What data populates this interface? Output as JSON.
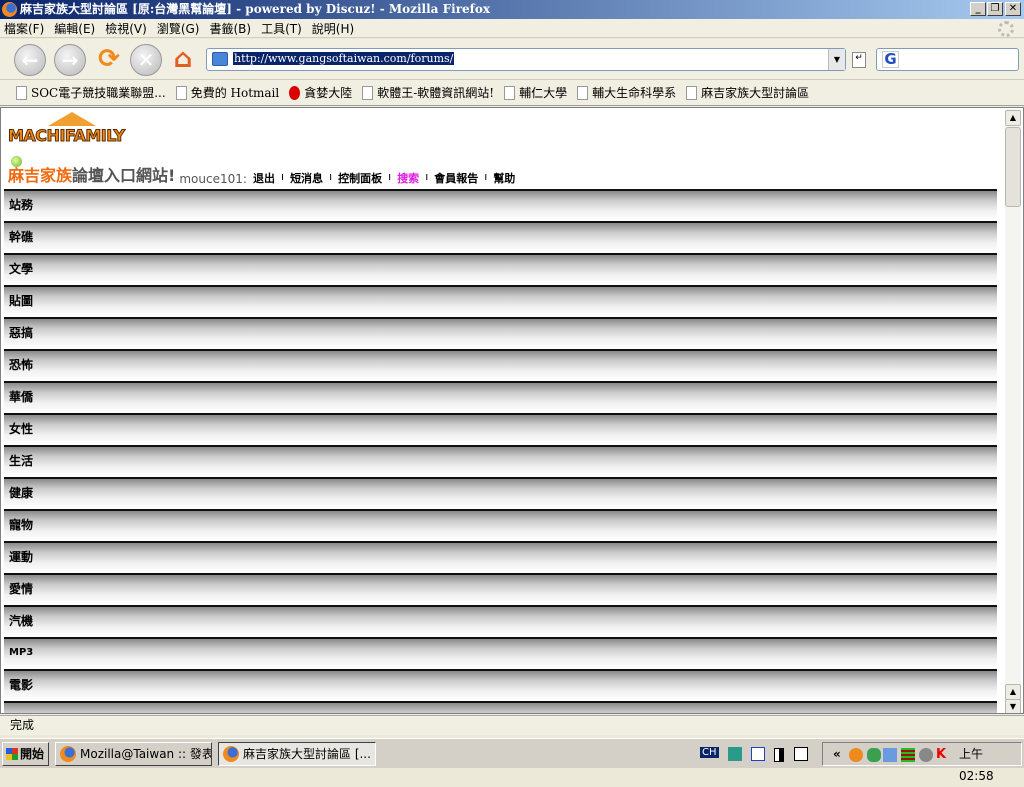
{
  "window": {
    "title": "麻吉家族大型討論區 [原:台灣黑幫論壇] - powered by Discuz! - Mozilla Firefox"
  },
  "menu": [
    "檔案(F)",
    "編輯(E)",
    "檢視(V)",
    "瀏覽(G)",
    "書籤(B)",
    "工具(T)",
    "說明(H)"
  ],
  "url": "http://www.gangsoftaiwan.com/forums/",
  "search": {
    "engine_label": "G"
  },
  "bookmarks": [
    "SOC電子競技職業聯盟...",
    "免費的 Hotmail",
    "貪婪大陸",
    "軟體王-軟體資訊網站!",
    "輔仁大學",
    "輔大生命科學系",
    "麻吉家族大型討論區"
  ],
  "page": {
    "logo": "MACHIFAMILY",
    "portal_a": "麻吉家族",
    "portal_b": "論壇入口網站!",
    "user": "mouce101:",
    "links": [
      "退出",
      "短消息",
      "控制面板",
      "搜索",
      "會員報告",
      "幫助"
    ],
    "categories": [
      "站務",
      "幹礁",
      "文學",
      "貼圖",
      "惡搞",
      "恐怖",
      "華僑",
      "女性",
      "生活",
      "健康",
      "寵物",
      "運動",
      "愛情",
      "汽機",
      "MP3",
      "電影"
    ]
  },
  "status": "完成",
  "taskbar": {
    "start": "開始",
    "tasks": [
      "Mozilla@Taiwan :: 發表...",
      "麻吉家族大型討論區 [..."
    ],
    "ime": "CH",
    "clock": "上午 02:58"
  }
}
